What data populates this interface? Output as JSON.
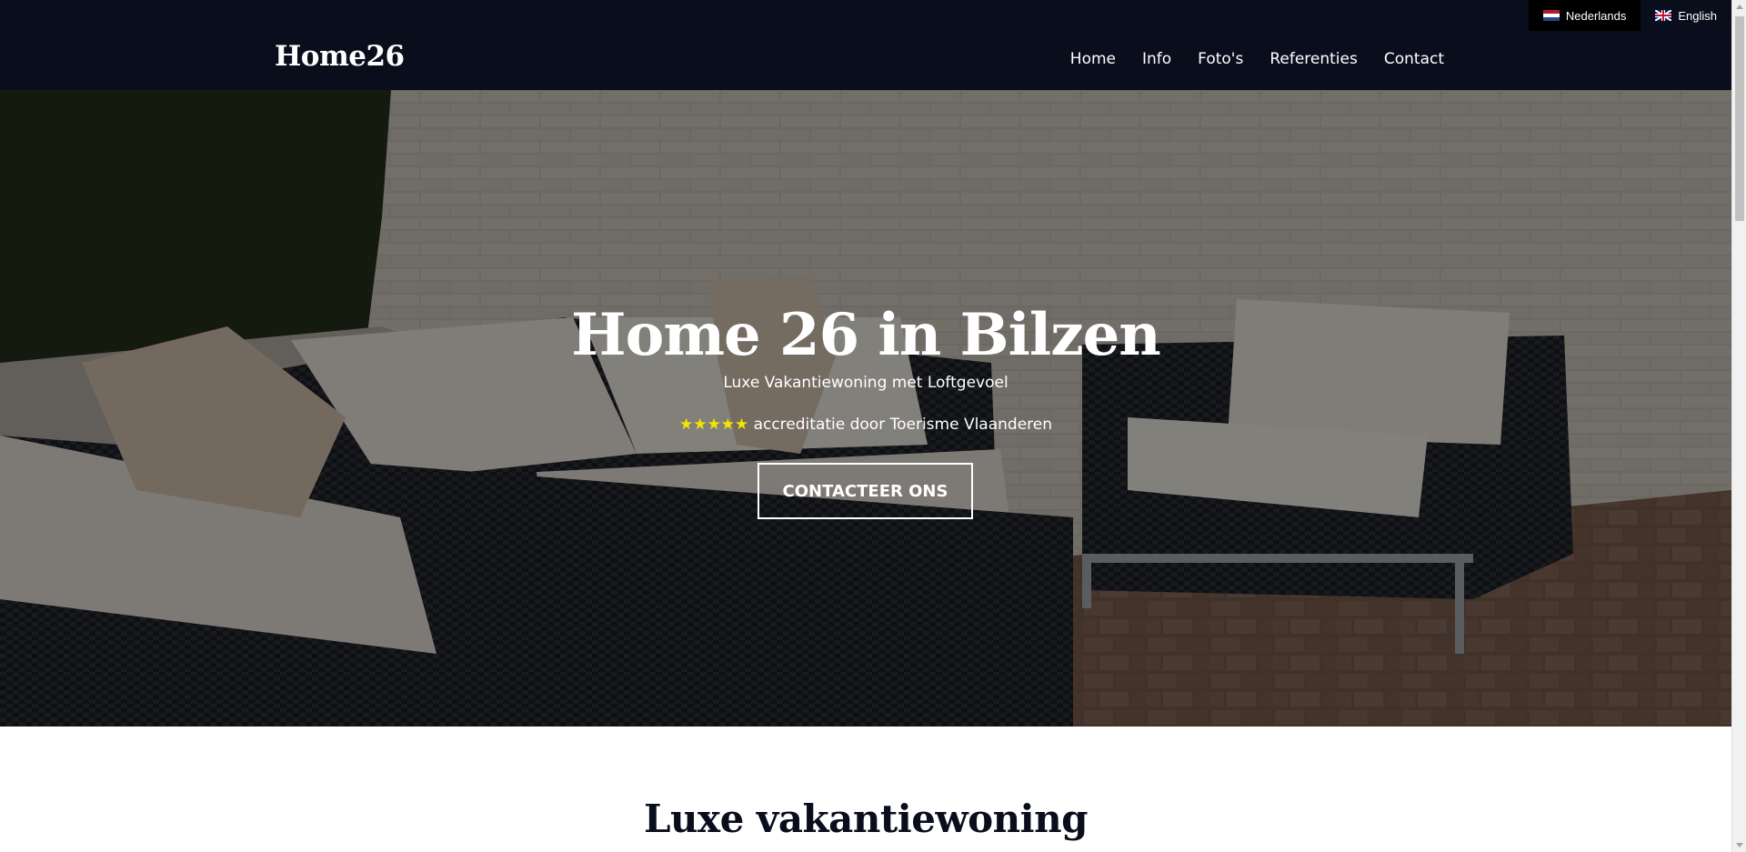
{
  "header": {
    "brand": "Home26",
    "nav": [
      "Home",
      "Info",
      "Foto's",
      "Referenties",
      "Contact"
    ],
    "languages": [
      {
        "label": "Nederlands",
        "flag": "nl-flag-icon",
        "active": true
      },
      {
        "label": "English",
        "flag": "gb-flag-icon",
        "active": false
      }
    ]
  },
  "hero": {
    "title": "Home 26 in Bilzen",
    "subtitle": "Luxe Vakantiewoning met Loftgevoel",
    "stars": "★★★★★",
    "rating_text": " accreditatie door Toerisme Vlaanderen",
    "cta": "CONTACTEER ONS"
  },
  "section": {
    "title": "Luxe vakantiewoning"
  },
  "colors": {
    "header_bg": "#0a0d1c",
    "star": "#f5e500",
    "title_dark": "#0a0d1c"
  }
}
